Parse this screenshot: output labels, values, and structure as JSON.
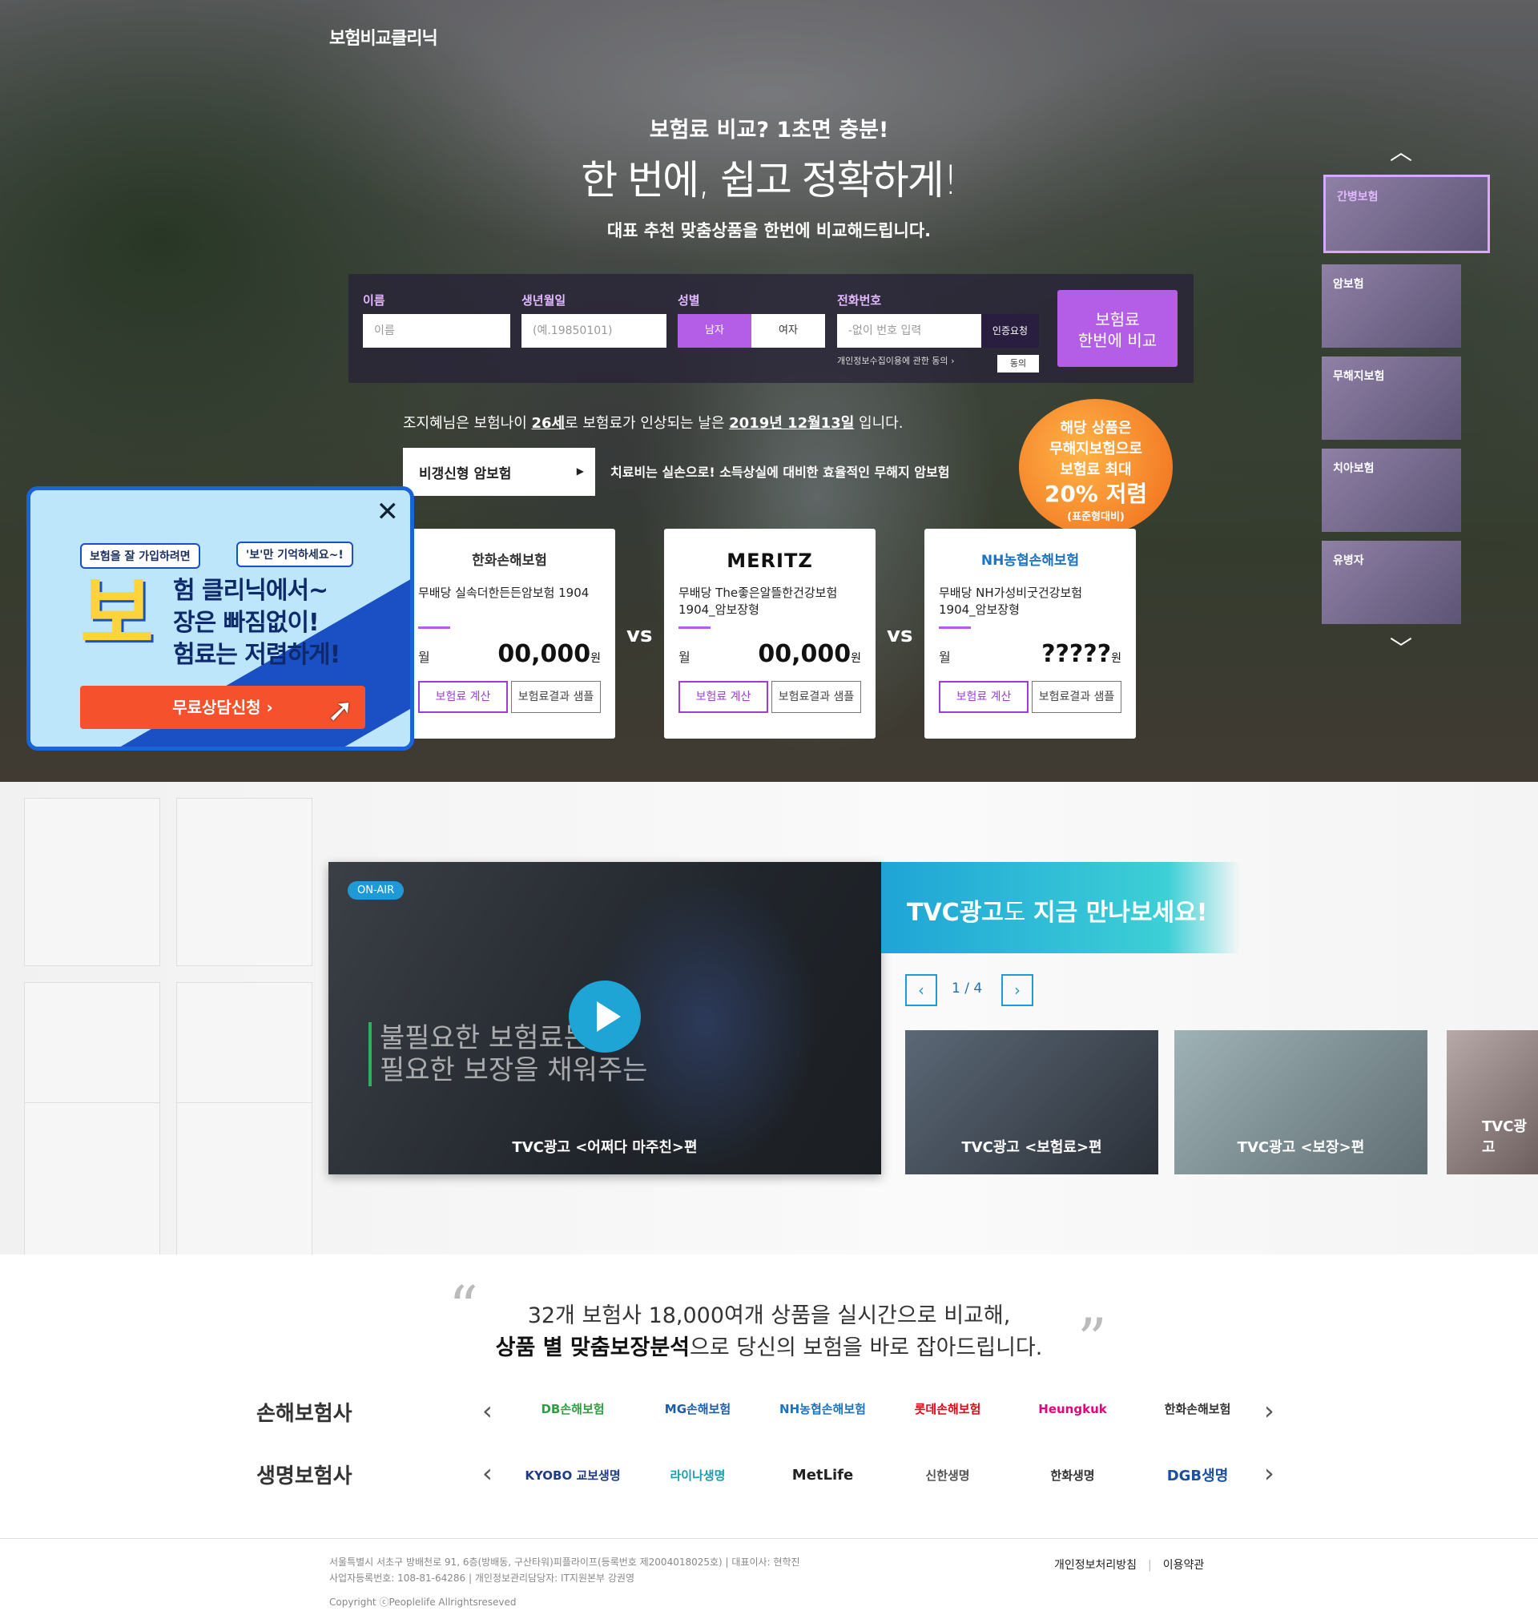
{
  "header": {
    "logo": "보험비교클리닉"
  },
  "hero": {
    "tag1": "보험료 비교? 1초면 충분!",
    "tag2": "한 번에, 쉽고 정확하게!",
    "tag3": "대표 추천 맞춤상품을 한번에 비교해드립니다."
  },
  "form": {
    "name_label": "이름",
    "name_placeholder": "이름",
    "birth_label": "생년월일",
    "birth_placeholder": "(예.19850101)",
    "gender_label": "성별",
    "male": "남자",
    "female": "여자",
    "phone_label": "전화번호",
    "phone_placeholder": "-없이 번호 입력",
    "auth_button": "인증요청",
    "consent_text": "개인정보수집이용에 관한 동의",
    "agree_button": "동의",
    "compare_line1": "보험료",
    "compare_line2": "한번에 비교"
  },
  "info": {
    "pre": "조지혜님은 보험나이 ",
    "age": "26세",
    "mid": "로 보험료가 인상되는 날은 ",
    "date": "2019년 12월13일",
    "post": " 입니다."
  },
  "product_select": {
    "value": "비갱신형 암보험",
    "desc": "치료비는 실손으로! 소득상실에 대비한 효율적인 무해지 암보험"
  },
  "badge": {
    "l1": "해당 상품은",
    "l2": "무해지보험으로",
    "l3": "보험료 최대",
    "l4": "20% 저렴",
    "l5": "(표준형대비)"
  },
  "cards": [
    {
      "brand": "한화손해보험",
      "product": "무배당 실속더한든든암보험 1904",
      "month": "월",
      "amount": "00,000",
      "unit": "원",
      "btn1": "보험료 계산",
      "btn2": "보험료결과 샘플",
      "color": "#e8641b"
    },
    {
      "brand": "MERITZ",
      "product": "무배당 The좋은알뜰한건강보험1904_암보장형",
      "month": "월",
      "amount": "00,000",
      "unit": "원",
      "btn1": "보험료 계산",
      "btn2": "보험료결과 샘플",
      "color": "#c8102e"
    },
    {
      "brand": "NH농협손해보험",
      "product": "무배당 NH가성비굿건강보험 1904_암보장형",
      "month": "월",
      "amount": "?????",
      "unit": "원",
      "btn1": "보험료 계산",
      "btn2": "보험료결과 샘플",
      "color": "#1a73c7"
    }
  ],
  "vs": "vs",
  "promo": {
    "bubble1": "보험을 잘 가입하려면",
    "bubble2": "'보'만 기억하세요~!",
    "big": "보",
    "line1": "험 클리닉에서~",
    "line2": "장은 빠짐없이!",
    "line3": "험료는 저렴하게!",
    "cta": "무료상담신청  ›"
  },
  "sidebar_thumbs": [
    "간병보험",
    "암보험",
    "무해지보험",
    "치아보험",
    "유병자"
  ],
  "tvc": {
    "onair": "ON-AIR",
    "overlay1": "불필요한 보험료는 빼",
    "overlay2": "필요한 보장을 채워주는",
    "main_title": "TVC광고 <어쩌다 마주친>편",
    "head_a": "TVC광고",
    "head_b": "도 ",
    "head_c": "지금 만나보세요!",
    "page": "1 / 4",
    "thumbs": [
      "TVC광고 <보험료>편",
      "TVC광고 <보장>편",
      "TVC광고"
    ]
  },
  "partners": {
    "quote1": "32개 보험사 18,000여개 상품을 실시간으로 비교해,",
    "quote2_bold": "상품 별 맞춤보장분석",
    "quote2_rest": "으로 당신의 보험을 바로 잡아드립니다.",
    "nonlife_label": "손해보험사",
    "life_label": "생명보험사",
    "nonlife": [
      {
        "name": "DB손해보험",
        "color": "#2e9e3f"
      },
      {
        "name": "MG손해보험",
        "color": "#1b5ea8"
      },
      {
        "name": "NH농협손해보험",
        "color": "#1a73c7"
      },
      {
        "name": "롯데손해보험",
        "color": "#e60012"
      },
      {
        "name": "Heungkuk",
        "color": "#e6007e"
      },
      {
        "name": "한화손해보험",
        "color": "#333333"
      }
    ],
    "life": [
      {
        "name": "KYOBO 교보생명",
        "color": "#1f3c88"
      },
      {
        "name": "라이나생명",
        "color": "#1a9cb0"
      },
      {
        "name": "MetLife",
        "color": "#222222"
      },
      {
        "name": "신한생명",
        "color": "#555555"
      },
      {
        "name": "한화생명",
        "color": "#333333"
      },
      {
        "name": "DGB생명",
        "color": "#1c4fa0"
      }
    ]
  },
  "footer": {
    "line1": "서울특별시 서초구 방배천로 91, 6층(방배동, 구산타워)피플라이프(등록번호 제2004018025호)   |   대표이사: 현학진",
    "line2": "사업자등록번호: 108-81-64286   |   개인정보관리담당자: IT지원본부 강권영",
    "copyright": "Copyright ⓒPeoplelife Allrightsreseved",
    "privacy": "개인정보처리방침",
    "terms": "이용약관"
  }
}
